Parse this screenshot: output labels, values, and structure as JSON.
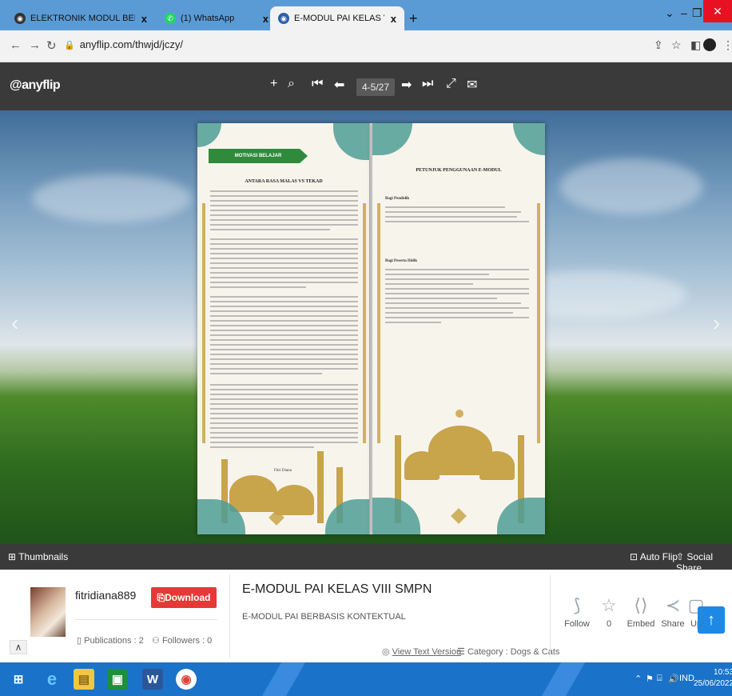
{
  "browser": {
    "tabs": [
      {
        "title": "ELEKTRONIK MODUL BERBASIS I",
        "close": "x",
        "icon": "anyflip-favicon",
        "active": false
      },
      {
        "title": "(1) WhatsApp",
        "close": "x",
        "icon": "whatsapp-favicon",
        "active": false
      },
      {
        "title": "E-MODUL PAI KELAS VIII SMPN",
        "close": "x",
        "icon": "anyflip-favicon",
        "active": true
      }
    ],
    "new_tab": "+",
    "url": "anyflip.com/thwjd/jczy/"
  },
  "reader": {
    "logo": "@anyflip",
    "page_indicator": "4-5/27",
    "left_page": {
      "ribbon": "MOTIVASI BELAJAR",
      "title": "ANTARA RASA MALAS VS TEKAD",
      "signature": "Fitri Diana"
    },
    "right_page": {
      "title": "PETUNJUK PENGGUNAAN E-MODUL",
      "section1": "Bagi Pendidik",
      "section2": "Bagi Peserta Didik"
    },
    "thumbnails": "Thumbnails",
    "auto_flip": "Auto Flip",
    "social_share": "Social Share"
  },
  "publisher": {
    "username": "fitridiana889",
    "download": "Download PDF",
    "publications": "Publications : 2",
    "followers": "Followers : 0"
  },
  "book": {
    "title": "E-MODUL PAI KELAS VIII SMPN",
    "subtitle": "E-MODUL PAI BERBASIS KONTEKTUAL",
    "view_text": "View Text Version",
    "category": "Category : Dogs & Cats"
  },
  "social": {
    "follow": "Follow",
    "likes": "0",
    "embed": "Embed",
    "share": "Share",
    "upload": "Up"
  },
  "taskbar": {
    "language": "IND",
    "time": "10:53",
    "date": "25/06/2022"
  },
  "colors": {
    "tab_strip": "#5b9bd5",
    "toolbar": "#3a3a3a",
    "download": "#e53935",
    "taskbar": "#1a73c8",
    "ribbon": "#2f8a3c",
    "ornament_teal": "#4f9e95",
    "ornament_gold": "#c8a44a"
  }
}
